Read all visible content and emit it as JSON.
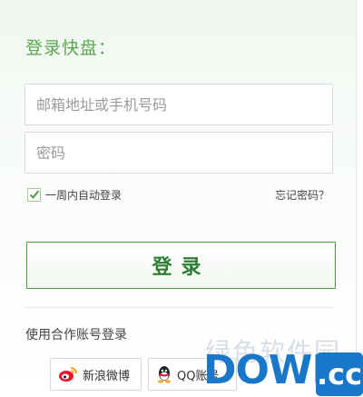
{
  "login": {
    "title": "登录快盘：",
    "email_placeholder": "邮箱地址或手机号码",
    "password_placeholder": "密码",
    "remember_label": "一周内自动登录",
    "remember_checked": true,
    "forgot_label": "忘记密码？",
    "submit_label": "登录"
  },
  "third_party": {
    "title": "使用合作账号登录",
    "providers": [
      {
        "name": "新浪微博",
        "icon": "weibo-icon"
      },
      {
        "name": "QQ账号",
        "icon": "qq-icon"
      }
    ]
  },
  "watermark": {
    "text": "绿色软件园",
    "logo_main": "DOWN",
    "logo_suffix": ".cc"
  },
  "colors": {
    "accent": "#5aa84e",
    "button_text": "#2e7d32",
    "watermark": "#1877c8"
  }
}
